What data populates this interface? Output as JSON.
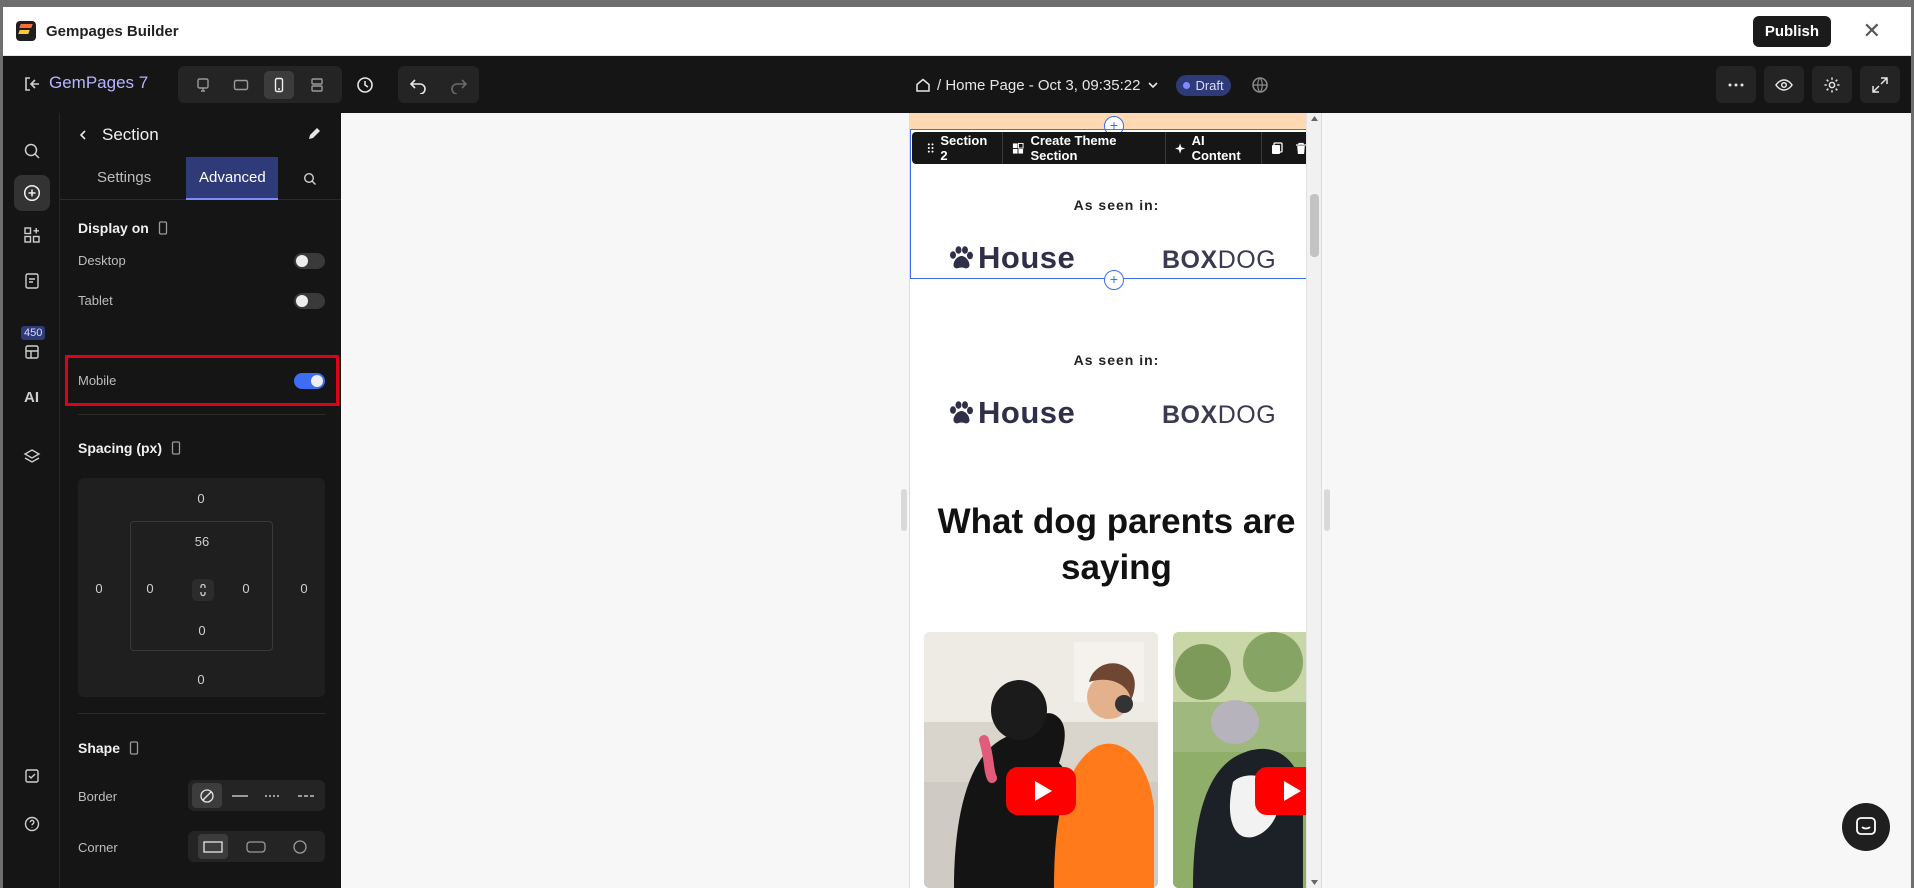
{
  "window": {
    "title": "Gempages Builder",
    "publish_label": "Publish"
  },
  "toolbar": {
    "brand": "GemPages 7",
    "breadcrumb": "/ Home Page - Oct 3, 09:35:22",
    "status": "Draft",
    "devices": [
      "desktop-large",
      "tablet-landscape",
      "mobile",
      "custom"
    ],
    "active_device": "mobile"
  },
  "rail": {
    "badge": "450",
    "ai_label": "AI"
  },
  "panel": {
    "title": "Section",
    "tabs": [
      "Settings",
      "Advanced"
    ],
    "active_tab": "Advanced",
    "display_on": {
      "title": "Display on",
      "items": [
        {
          "label": "Desktop",
          "enabled": false
        },
        {
          "label": "Tablet",
          "enabled": false
        },
        {
          "label": "Mobile",
          "enabled": true
        }
      ]
    },
    "spacing": {
      "title": "Spacing (px)",
      "margin": {
        "top": "0",
        "right": "0",
        "bottom": "0",
        "left": "0"
      },
      "padding": {
        "top": "56",
        "right": "0",
        "bottom": "0",
        "left": "0"
      }
    },
    "shape": {
      "title": "Shape",
      "border_label": "Border",
      "corner_label": "Corner"
    }
  },
  "preview": {
    "section_toolbar": {
      "section": "Section 2",
      "create_theme": "Create Theme Section",
      "ai_content": "AI Content"
    },
    "seen_in_1": "As seen in:",
    "seen_in_2": "As seen in:",
    "logo_house": "House",
    "logo_boxdog_bold": "BOX",
    "logo_boxdog_light": "DOG",
    "headline": "What dog parents are saying"
  }
}
